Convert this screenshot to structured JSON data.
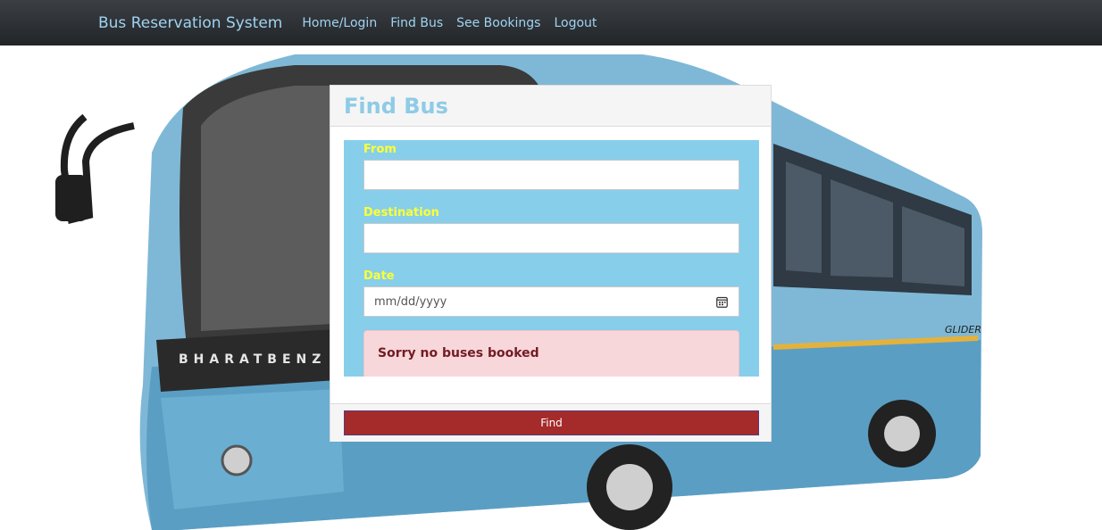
{
  "navbar": {
    "brand": "Bus Reservation System",
    "links": [
      "Home/Login",
      "Find Bus",
      "See Bookings",
      "Logout"
    ]
  },
  "card": {
    "title": "Find Bus",
    "fields": {
      "from_label": "From",
      "from_value": "",
      "destination_label": "Destination",
      "destination_value": "",
      "date_label": "Date",
      "date_placeholder": "mm/dd/yyyy"
    },
    "alert": "Sorry no buses booked",
    "find_button": "Find"
  },
  "colors": {
    "navbar_bg": "#2b2f33",
    "link": "#9fd3f2",
    "card_title": "#8ecbe6",
    "form_bg": "#87ceeb",
    "field_label": "#ffff33",
    "alert_bg": "#f8d7da",
    "alert_text": "#721c24",
    "button_bg": "#a52a2a"
  },
  "icons": {
    "date_picker": "calendar-icon"
  }
}
